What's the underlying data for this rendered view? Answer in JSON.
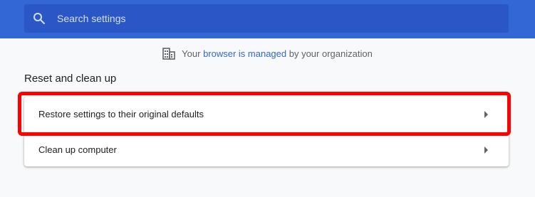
{
  "search": {
    "placeholder": "Search settings"
  },
  "managed": {
    "prefix": "Your ",
    "link": "browser is managed",
    "suffix": " by your organization"
  },
  "section": {
    "title": "Reset and clean up",
    "items": [
      {
        "label": "Restore settings to their original defaults"
      },
      {
        "label": "Clean up computer"
      }
    ]
  },
  "icons": {
    "search": "search-icon",
    "managed": "building-icon",
    "row_arrow": "arrow-right-icon"
  },
  "colors": {
    "header": "#3367d6",
    "search_box": "#2a56c6",
    "highlight": "#ff0000",
    "link": "#3367d6"
  }
}
